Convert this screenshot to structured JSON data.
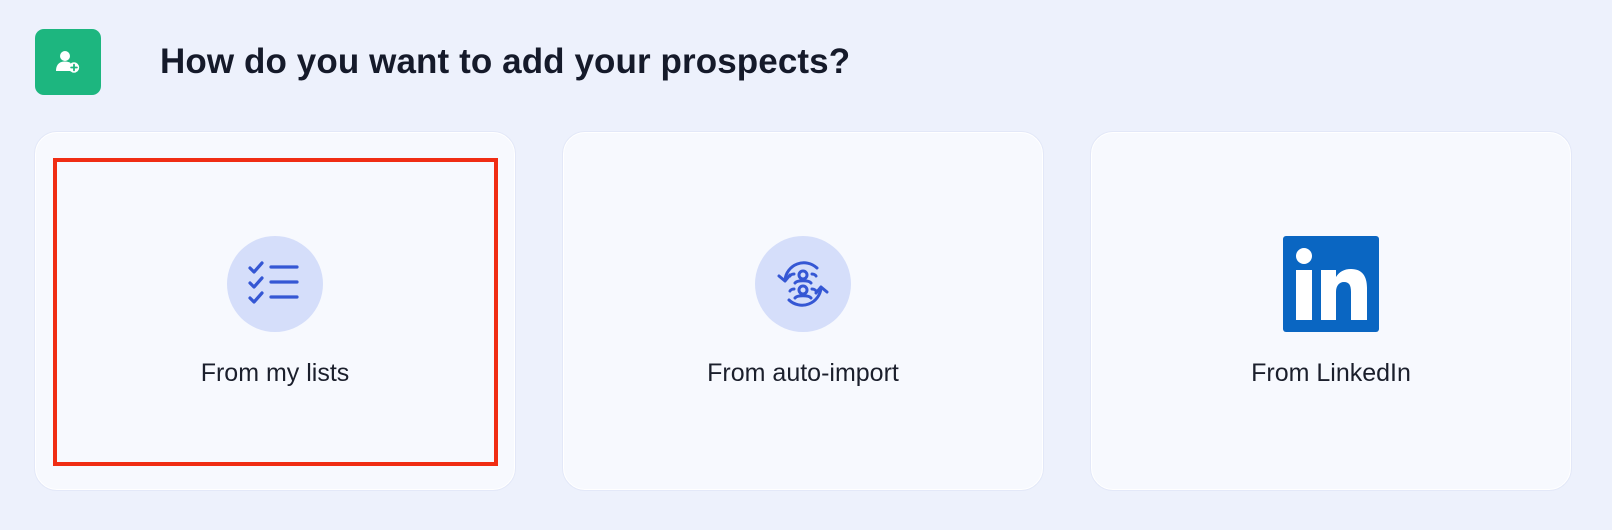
{
  "header": {
    "icon": "user-add-icon",
    "title": "How do you want to add your prospects?",
    "accent_color": "#1db67f"
  },
  "options": [
    {
      "label": "From my lists",
      "icon": "checklist-icon",
      "selected": true
    },
    {
      "label": "From auto-import",
      "icon": "sync-users-icon",
      "selected": false
    },
    {
      "label": "From LinkedIn",
      "icon": "linkedin-icon",
      "selected": false
    }
  ],
  "colors": {
    "icon_blue": "#3557d4",
    "icon_circle": "#d5defa",
    "linkedin_blue": "#0a66c2",
    "selection_outline": "#f02d14"
  }
}
